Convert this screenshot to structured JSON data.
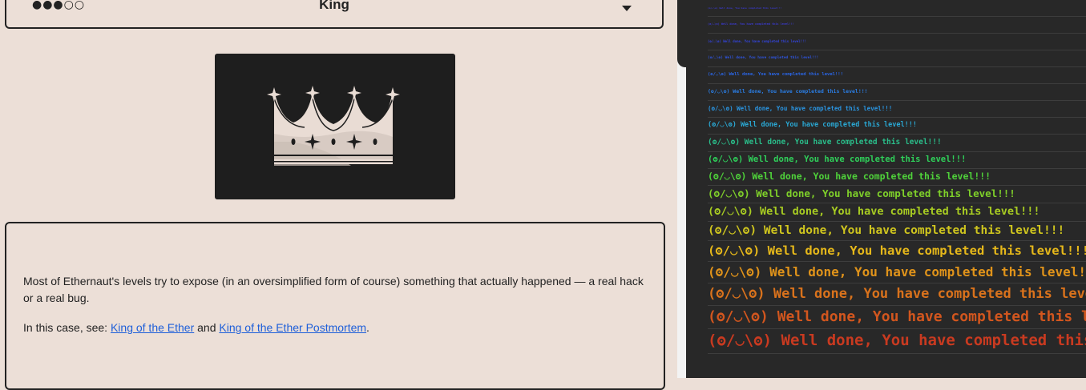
{
  "level": {
    "difficulty": "●●●○○",
    "name": "King"
  },
  "description": {
    "paragraph1": "Most of Ethernaut's levels try to expose (in an oversimplified form of course) something that actually happened — a real hack or a real bug.",
    "paragraph2_prefix": "In this case, see: ",
    "link1": "King of the Ether",
    "paragraph2_middle": " and ",
    "link2": "King of the Ether Postmortem",
    "paragraph2_suffix": "."
  },
  "console": {
    "message": "(ʘ/◡\\ʘ) Well done, You have completed this level!!!",
    "colors": [
      "#3a3acc",
      "#3a3acc",
      "#3344dd",
      "#2f55e0",
      "#2a66e8",
      "#2a7ee6",
      "#2a94df",
      "#2aa8d4",
      "#2abd8a",
      "#2fd05a",
      "#4fd23a",
      "#7fd02a",
      "#a8cc22",
      "#cfc51e",
      "#e6b81a",
      "#e0931a",
      "#d9721c",
      "#d2561e",
      "#c93a20"
    ]
  },
  "colors": {
    "page_bg": "#ecdfd7",
    "link": "#1e5fd9",
    "devtools_bg": "#282828"
  },
  "icons": {
    "dropdown": "caret-down-icon",
    "level_image": "crown-icon"
  }
}
